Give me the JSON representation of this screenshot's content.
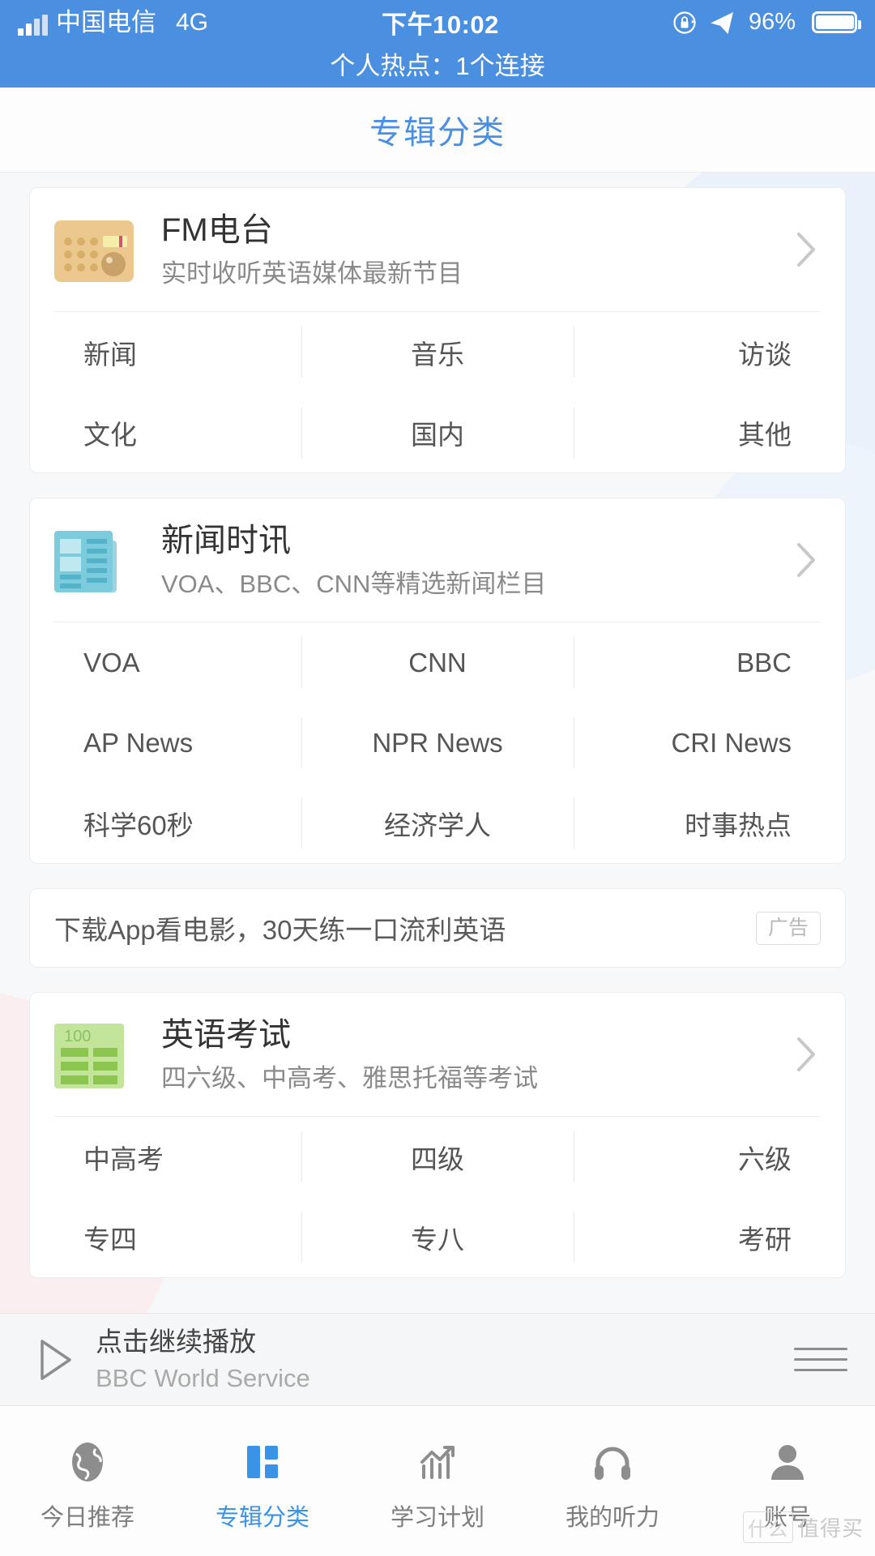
{
  "statusbar": {
    "carrier": "中国电信",
    "network": "4G",
    "time": "下午10:02",
    "battery_percent": "96%",
    "signal_icon": "signal-bars-icon",
    "rotation_lock_icon": "rotation-lock-icon",
    "location_icon": "location-arrow-icon",
    "battery_icon": "battery-icon"
  },
  "hotspot": {
    "text": "个人热点：1个连接"
  },
  "header": {
    "title": "专辑分类",
    "accent_color": "#4a90e2"
  },
  "cards": [
    {
      "icon": "fm-radio-icon",
      "title": "FM电台",
      "subtitle": "实时收听英语媒体最新节目",
      "chevron": "chevron-right-icon",
      "items": [
        "新闻",
        "音乐",
        "访谈",
        "文化",
        "国内",
        "其他"
      ]
    },
    {
      "icon": "newspaper-icon",
      "title": "新闻时讯",
      "subtitle": "VOA、BBC、CNN等精选新闻栏目",
      "chevron": "chevron-right-icon",
      "items": [
        "VOA",
        "CNN",
        "BBC",
        "AP News",
        "NPR News",
        "CRI News",
        "科学60秒",
        "经济学人",
        "时事热点"
      ]
    },
    {
      "icon": "exam-score-icon",
      "icon_label": "100",
      "title": "英语考试",
      "subtitle": "四六级、中高考、雅思托福等考试",
      "chevron": "chevron-right-icon",
      "items": [
        "中高考",
        "四级",
        "六级",
        "专四",
        "专八",
        "考研"
      ]
    }
  ],
  "ad": {
    "text": "下载App看电影，30天练一口流利英语",
    "badge": "广告"
  },
  "player": {
    "play_icon": "play-triangle-icon",
    "title": "点击继续播放",
    "subtitle": "BBC World Service",
    "menu_icon": "hamburger-menu-icon"
  },
  "tabs": [
    {
      "icon": "globe-icon",
      "label": "今日推荐",
      "active": false
    },
    {
      "icon": "grid-blocks-icon",
      "label": "专辑分类",
      "active": true
    },
    {
      "icon": "chart-growth-icon",
      "label": "学习计划",
      "active": false
    },
    {
      "icon": "headphones-icon",
      "label": "我的听力",
      "active": false
    },
    {
      "icon": "person-icon",
      "label": "账号",
      "active": false
    }
  ],
  "watermark": {
    "text": "值得买",
    "logo": "什么"
  }
}
